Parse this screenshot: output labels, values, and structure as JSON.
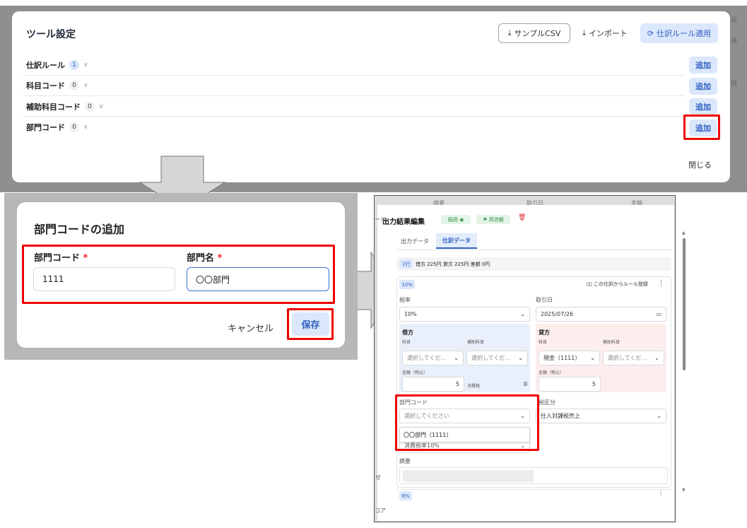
{
  "tool_settings": {
    "title": "ツール設定",
    "sample_csv_label": "サンプルCSV",
    "import_label": "インポート",
    "apply_rules_label": "仕訳ルール適用",
    "rows": [
      {
        "label": "仕訳ルール",
        "count": "1"
      },
      {
        "label": "科目コード",
        "count": "0"
      },
      {
        "label": "補助科目コード",
        "count": "0"
      },
      {
        "label": "部門コード",
        "count": "0"
      }
    ],
    "add_label": "追加",
    "close_label": "閉じる"
  },
  "add_dept_dialog": {
    "title": "部門コードの追加",
    "code_label": "部門コード",
    "name_label": "部門名",
    "required_mark": "*",
    "code_value": "1111",
    "name_value": "〇〇部門",
    "cancel_label": "キャンセル",
    "save_label": "保存"
  },
  "output_editor": {
    "title": "出力結果編集",
    "badge_read": "既読",
    "badge_confidence": "高信頼",
    "tabs": [
      "出力データ",
      "仕訳データ"
    ],
    "summary": {
      "rows": "2行",
      "text": "借方 225円 貸方 225円 差額 0円"
    },
    "tax_tag": "10%",
    "register_rule": "この仕訳からルール登録",
    "tax_rate_label": "税率",
    "tax_rate_value": "10%",
    "date_label": "取引日",
    "date_value": "2025/07/26",
    "debit": {
      "title": "借方",
      "account_label": "科目",
      "sub_label": "補助科目",
      "account_placeholder": "選択してくだ…",
      "sub_placeholder": "選択してくだ…",
      "amount_label": "金額（税込）",
      "amount_value": "5",
      "tax_label": "消費税",
      "tax_value": "0"
    },
    "credit": {
      "title": "貸方",
      "account_label": "科目",
      "sub_label": "補助科目",
      "account_value": "現金（1111）",
      "sub_placeholder": "選択してくだ…",
      "amount_label": "金額（税込）",
      "amount_value": "5"
    },
    "dept_label": "部門コード",
    "dept_placeholder": "選択してください",
    "dept_option": "〇〇部門（1111）",
    "dept_hidden_text": "消費税率10%",
    "tax_class_label": "税区分",
    "tax_class_value": "仕入対課税売上",
    "memo_label": "摘要",
    "next_tag": "8%",
    "bg_headers": [
      "摘要",
      "取引日",
      "金額"
    ],
    "side_fragments": [
      "ード",
      "せ",
      "コア"
    ]
  },
  "right_edge_fragments": [
    "設",
    "用",
    "用"
  ],
  "colors": {
    "highlight": "#ee0000",
    "accent": "#2d5fbf",
    "accent_bg": "#dbe7fb"
  }
}
